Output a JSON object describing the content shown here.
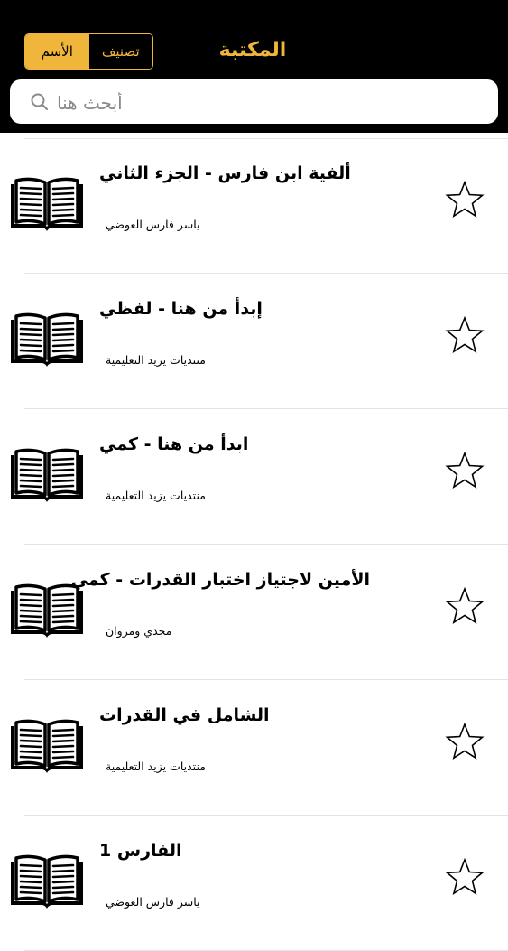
{
  "header": {
    "title": "المكتبة",
    "sort": {
      "name_label": "الأسم",
      "category_label": "تصنيف",
      "selected": "name"
    }
  },
  "search": {
    "placeholder": "أبحث هنا"
  },
  "colors": {
    "accent": "#f0b63c",
    "header_bg": "#000000",
    "divider": "#e4e4e4"
  },
  "books": [
    {
      "title": "ألفية ابن فارس - الجزء الثاني",
      "author": "ياسر فارس العوضي",
      "favorite": false,
      "icon": "open-book-icon"
    },
    {
      "title": "إبدأ من هنا - لفظي",
      "author": "منتديات يزيد التعليمية",
      "favorite": false,
      "icon": "open-book-icon"
    },
    {
      "title": "ابدأ من هنا - كمي",
      "author": "منتديات يزيد التعليمية",
      "favorite": false,
      "icon": "open-book-icon"
    },
    {
      "title": "الأمين لاجتياز اختبار القدرات - كمي",
      "author": "مجدي ومروان",
      "favorite": false,
      "icon": "open-book-icon"
    },
    {
      "title": "الشامل في القدرات",
      "author": "منتديات يزيد التعليمية",
      "favorite": false,
      "icon": "open-book-icon"
    },
    {
      "title": "الفارس 1",
      "author": "ياسر فارس العوضي",
      "favorite": false,
      "icon": "open-book-icon"
    }
  ]
}
